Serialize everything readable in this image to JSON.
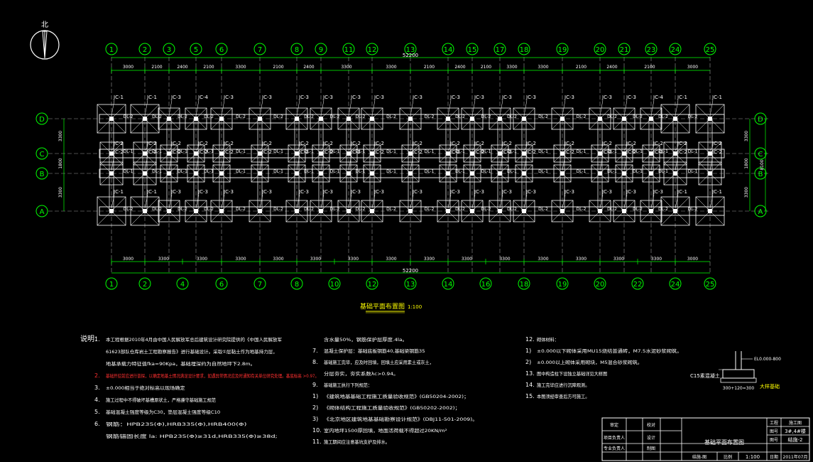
{
  "colors": {
    "background": "#000000",
    "grid": "#c8c8c8",
    "axis": "#00ff00",
    "dim": "#00ff00",
    "footing": "#ffffff",
    "label": "#ffffff",
    "title": "#ffff00",
    "note": "#ffffff",
    "note_red": "#ff3030",
    "frame": "#ffffff"
  },
  "top_axes": [
    "1",
    "2",
    "3",
    "5",
    "6",
    "7",
    "8",
    "9",
    "11",
    "12",
    "13",
    "14",
    "15",
    "17",
    "18",
    "19",
    "20",
    "21",
    "23",
    "24",
    "25"
  ],
  "bottom_axes": [
    "1",
    "2",
    "4",
    "6",
    "7",
    "8",
    "10",
    "12",
    "13",
    "14",
    "16",
    "18",
    "19",
    "20",
    "22",
    "24",
    "25"
  ],
  "row_axes": [
    "D",
    "C",
    "B",
    "A"
  ],
  "top_dims": [
    "3000",
    "2100",
    "2400",
    "2100",
    "3300",
    "2100",
    "2400",
    "3300",
    "3300",
    "2100",
    "2400",
    "2100",
    "3300",
    "3300",
    "2100",
    "2400",
    "2100",
    "3000"
  ],
  "top_total": "52200",
  "bottom_dims": [
    "3000",
    "3300",
    "3300",
    "3300",
    "3300",
    "3300",
    "3300",
    "3300",
    "3300",
    "3300",
    "3300",
    "3300",
    "3300",
    "3300",
    "3300",
    "3000"
  ],
  "bottom_total": "52200",
  "side_dims": [
    "3300",
    "1800",
    "3300"
  ],
  "side_total": "8100",
  "labels": {
    "jc1": "JC-1",
    "jc2": "JC-2",
    "jc3": "JC-3",
    "jc4": "JC-4",
    "dl1": "DL-1",
    "dl2": "DL-2"
  },
  "plan_title": "基础平面布置图",
  "plan_scale": "1:100",
  "north": "北",
  "notes_label": "说明：",
  "notes_col1": [
    {
      "n": "1.",
      "t": "本工程根据2010年4月由中国人民解放军总后建筑设计研究院提供的《中国人民解放军"
    },
    {
      "n": "",
      "t": "61623部队仓库岩土工程勘察报告》进行基础设计。采取①层黏土作为地基持力层，"
    },
    {
      "n": "",
      "t": "地基承载力特征值fka=90Kpa，基础埋深约为自然地坪下2.8m。"
    },
    {
      "n": "2.",
      "t": "基础开挖前应进行普探，以确定地基土情况满足设计要求，如遇异常情况应及时通知有关单位研究处理。基底标高 >0.97。",
      "red": true
    },
    {
      "n": "3.",
      "t": "±0.000相当于绝对标高以现场确定"
    },
    {
      "n": "4.",
      "t": "施工过程中不得破坏基槽原状土，严格遵守基础施工规范"
    },
    {
      "n": "5.",
      "t": "基础混凝土强度等级为C30，垫层混凝土强度等级C10"
    },
    {
      "n": "6.",
      "t": "钢筋：HPB235(Φ),HRB335(Φ),HRB400(Φ)"
    },
    {
      "n": "",
      "t": "钢筋锚固长度 la: HPB235(Φ)≥31d,HRB335(Φ)≥38d;"
    }
  ],
  "notes_col2": [
    {
      "n": "",
      "t": "含水量50%，钢筋保护层厚度.4la。"
    },
    {
      "n": "7.",
      "t": "混凝土保护层：基础底板钢筋40,基础梁钢筋35"
    },
    {
      "n": "8.",
      "t": "基础施工完毕，应及时回填，回填土应采用素土或灰土，"
    },
    {
      "n": "",
      "t": "分层夯实，夯实系数λc>0.94。"
    },
    {
      "n": "9.",
      "t": "基础施工执行下列规范："
    },
    {
      "n": "1)",
      "t": "《建筑地基基础工程施工质量验收规范》(GB50204-2002)；"
    },
    {
      "n": "2)",
      "t": "《砌体结构工程施工质量验收规范》(GB50202-2002)；"
    },
    {
      "n": "3)",
      "t": "《北京地区建筑地基基础勘察设计规范》(DBJ11-501-2009)。"
    },
    {
      "n": "10.",
      "t": "室内地坪1500厚回填，地面活荷载不得超过20KN/m²"
    },
    {
      "n": "11.",
      "t": "施工期间应注意基坑支护及排水。"
    }
  ],
  "notes_col3": [
    {
      "n": "12.",
      "t": "砌体材料："
    },
    {
      "n": "1)",
      "t": "±0.000以下砌体采用MU15烧结普通砖，M7.5水泥砂浆砌筑。"
    },
    {
      "n": "2)",
      "t": "±0.000以上砌体采用砌块，M5混合砂浆砌筑。"
    },
    {
      "n": "13.",
      "t": "图中构造柱下设独立基础详见大样图"
    },
    {
      "n": "14.",
      "t": "施工完毕应进行沉降观测。"
    },
    {
      "n": "15.",
      "t": "本图须经审查后方可施工。"
    }
  ],
  "detail": {
    "label1": "C15素混凝土",
    "label2": "EL0.000-800",
    "caption": "大样基础",
    "dim": "300+120=300"
  },
  "title_block": {
    "row1_left": [
      "审定",
      "",
      "校对",
      ""
    ],
    "row2_left": [
      "项目负责人",
      "",
      "设计",
      ""
    ],
    "row3_left": [
      "专业负责人",
      "",
      "制图",
      ""
    ],
    "drawing_name": "基础平面布置图",
    "proj_label": "工程",
    "proj_value": "施工图",
    "no_label": "图号",
    "no_value": "3#,4#楼",
    "sheet_label": "图号",
    "sheet_value": "结施-2",
    "scale_label": "比例",
    "scale_value": "1:100",
    "code": "结施-图",
    "date_label": "日期",
    "date_value": "2011年07月"
  }
}
